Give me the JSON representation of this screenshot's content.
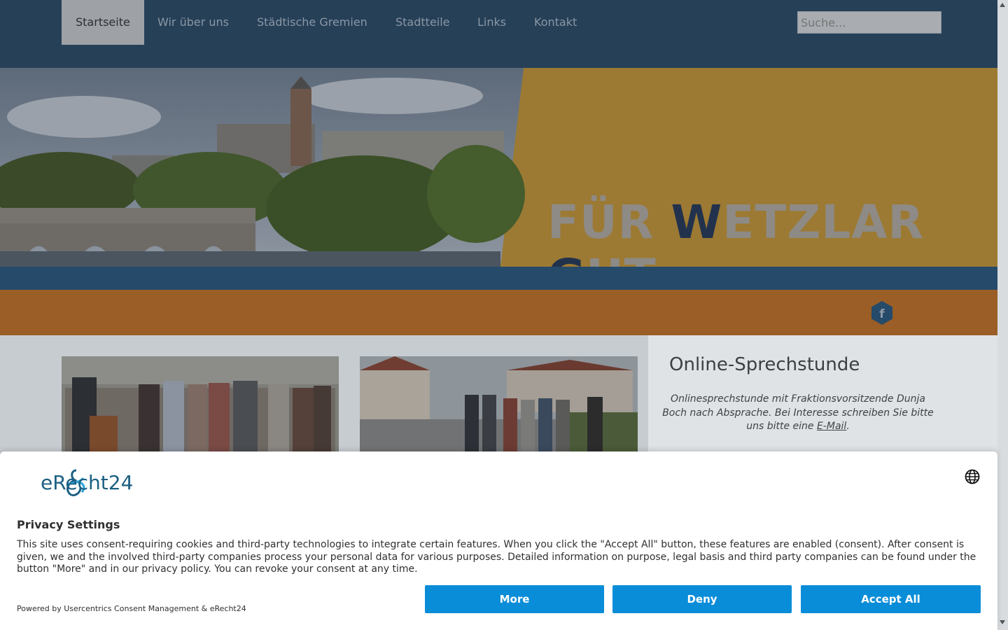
{
  "nav": {
    "items": [
      {
        "label": "Startseite",
        "active": true
      },
      {
        "label": "Wir über uns"
      },
      {
        "label": "Städtische Gremien"
      },
      {
        "label": "Stadtteile"
      },
      {
        "label": "Links"
      },
      {
        "label": "Kontakt"
      }
    ],
    "search_placeholder": "Suche..."
  },
  "hero": {
    "slogan_parts": [
      "FÜR ",
      "W",
      "ETZLAR ",
      "G",
      "UT"
    ]
  },
  "social": {
    "facebook_icon": "facebook-icon"
  },
  "sidebar": {
    "title": "Online-Sprechstunde",
    "text": "Onlinesprechstunde mit Fraktionsvorsitzende Dunja Boch nach Absprache. Bei Interesse schreiben Sie bitte uns bitte eine",
    "link": "E-Mail",
    "tail": "."
  },
  "consent": {
    "brand": "eRecht24",
    "title": "Privacy Settings",
    "description": "This site uses consent-requiring cookies and third-party technologies to integrate certain features. When you click the \"Accept All\" button, these features are enabled (consent). After consent is given, we and the involved third-party companies process your personal data for various purposes. Detailed information on purpose, legal basis and third party companies can be found under the button \"More\" and in our privacy policy. You can revoke your consent at any time.",
    "buttons": {
      "more": "More",
      "deny": "Deny",
      "accept": "Accept All"
    },
    "powered_by": "Powered by Usercentrics Consent Management & eRecht24",
    "language_icon": "globe-icon"
  },
  "colors": {
    "nav_bg": "#264058",
    "hero_orange": "#9c7a33",
    "band_blue": "#264a6a",
    "band_orange": "#9a5e26",
    "button_blue": "#0a8dd8"
  }
}
